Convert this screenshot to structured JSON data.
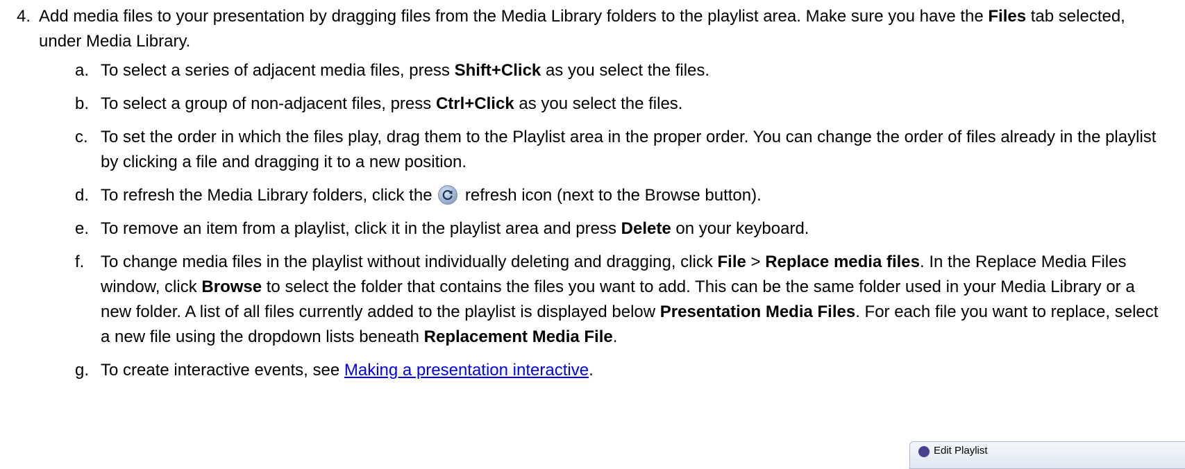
{
  "step4": {
    "number": "4.",
    "p1": "Add media files to your presentation by dragging files from the Media Library folders to the playlist area. Make sure you have the ",
    "files_tab": "Files",
    "p2": " tab selected, under Media Library."
  },
  "subitems": {
    "a": {
      "letter": "a.",
      "p1": "To select a series of adjacent media files, press ",
      "b1": "Shift+Click",
      "p2": " as you select the files."
    },
    "b": {
      "letter": "b.",
      "p1": "To select a group of non-adjacent files, press ",
      "b1": "Ctrl+Click",
      "p2": " as you select the files."
    },
    "c": {
      "letter": "c.",
      "text": "To set the order in which the files play, drag them to the Playlist area in the proper order. You can change the order of files already in the playlist by clicking a file and dragging it to a new position."
    },
    "d": {
      "letter": "d.",
      "p1": "To refresh the Media Library folders, click the",
      "icon": "refresh-icon",
      "p2": " refresh icon (next to the Browse button)."
    },
    "e": {
      "letter": "e.",
      "p1": "To remove an item from a playlist, click it in the playlist area and press ",
      "b1": "Delete",
      "p2": " on your keyboard."
    },
    "f": {
      "letter": "f.",
      "p1": "To change media files in the playlist without individually deleting and dragging, click ",
      "b1": "File",
      "p2": " > ",
      "b2": "Replace media files",
      "p3": ". In the Replace Media Files window, click ",
      "b3": "Browse",
      "p4": " to select the folder that contains the files you want to add. This can be the same folder used in your Media Library or a new folder. A list of all files currently added to the playlist is displayed below ",
      "b4": "Presentation Media Files",
      "p5": ". For each file you want to replace, select a new file using the dropdown lists beneath ",
      "b5": "Replacement Media File",
      "p6": "."
    },
    "g": {
      "letter": "g.",
      "p1": "To create interactive events, see ",
      "link": "Making a presentation interactive",
      "p2": "."
    }
  },
  "window_snippet": {
    "title": "Edit Playlist",
    "icon": "app-icon"
  },
  "colors": {
    "link": "#0000ee",
    "text": "#000000"
  }
}
